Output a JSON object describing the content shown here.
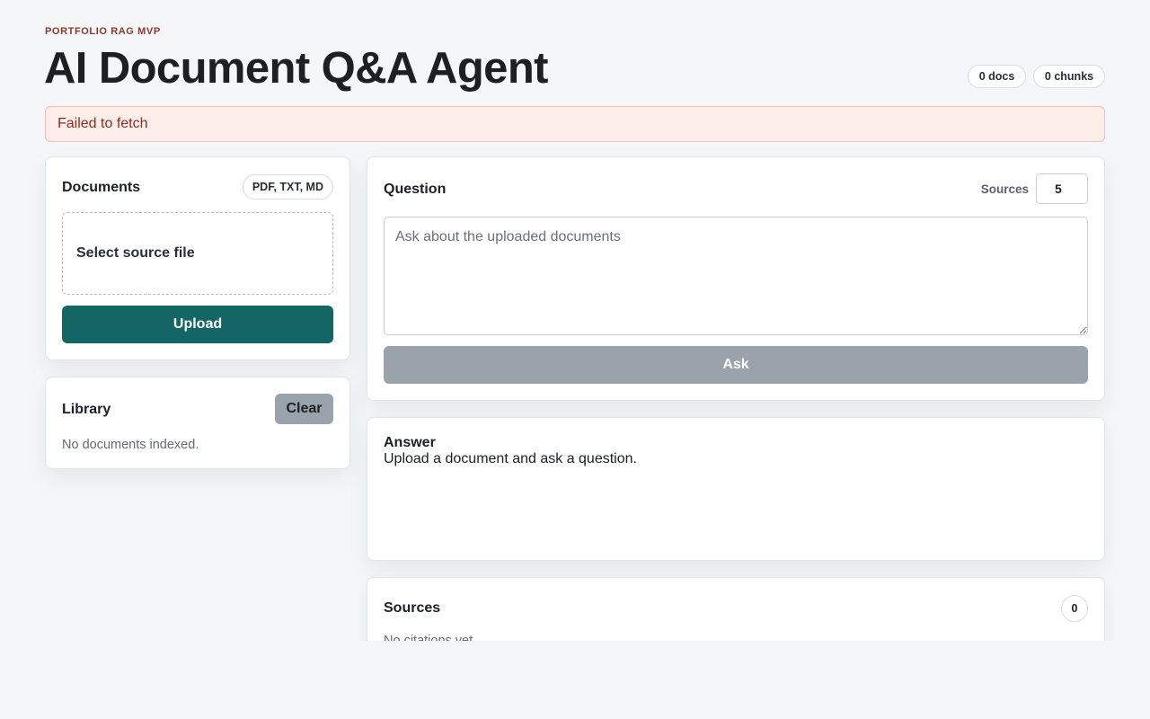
{
  "header": {
    "eyebrow": "PORTFOLIO RAG MVP",
    "title": "AI Document Q&A Agent",
    "docs_count": "0 docs",
    "chunks_count": "0 chunks"
  },
  "alert": {
    "message": "Failed to fetch"
  },
  "documents": {
    "title": "Documents",
    "types_badge": "PDF, TXT, MD",
    "dropzone_label": "Select source file",
    "upload_label": "Upload"
  },
  "library": {
    "title": "Library",
    "clear_label": "Clear",
    "empty_text": "No documents indexed."
  },
  "question": {
    "title": "Question",
    "sources_label": "Sources",
    "sources_value": "5",
    "placeholder": "Ask about the uploaded documents",
    "ask_label": "Ask"
  },
  "answer": {
    "title": "Answer",
    "text": "Upload a document and ask a question."
  },
  "sources": {
    "title": "Sources",
    "count": "0",
    "empty_text": "No citations yet."
  },
  "colors": {
    "background": "#f5f6f8",
    "primary_button": "#136664",
    "disabled_button": "#9aa3ab",
    "alert_background": "#fdeeea",
    "alert_text": "#8c2c22",
    "eyebrow": "#8a3a2c"
  }
}
